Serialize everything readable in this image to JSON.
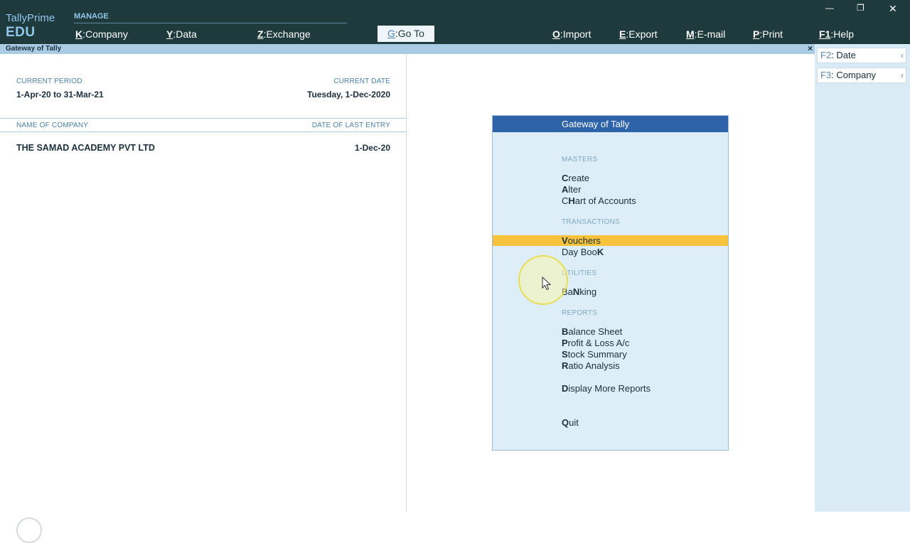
{
  "brand": {
    "name": "TallyPrime",
    "edition": "EDU"
  },
  "manage": {
    "label": "MANAGE"
  },
  "menu": [
    {
      "key": "K",
      "label": "Company"
    },
    {
      "key": "Y",
      "label": "Data"
    },
    {
      "key": "Z",
      "label": "Exchange"
    },
    {
      "key": "G",
      "label": "Go To"
    },
    {
      "key": "O",
      "label": "Import"
    },
    {
      "key": "E",
      "label": "Export"
    },
    {
      "key": "M",
      "label": "E-mail"
    },
    {
      "key": "P",
      "label": "Print"
    },
    {
      "key": "F1",
      "label": "Help"
    }
  ],
  "window_controls": {
    "minimize": "—",
    "restore": "❐",
    "close": "✕"
  },
  "subbar": {
    "title": "Gateway of Tally",
    "close": "×"
  },
  "sidebar": [
    {
      "key": "F2",
      "label": "Date",
      "chevron": "‹"
    },
    {
      "key": "F3",
      "label": "Company",
      "chevron": "‹"
    }
  ],
  "period": {
    "label": "CURRENT PERIOD",
    "value": "1-Apr-20 to 31-Mar-21",
    "date_label": "CURRENT DATE",
    "date_value": "Tuesday, 1-Dec-2020"
  },
  "company_table": {
    "col_name": "NAME OF COMPANY",
    "col_date": "DATE OF LAST ENTRY",
    "rows": [
      {
        "name": "THE SAMAD ACADEMY PVT LTD",
        "date": "1-Dec-20"
      }
    ]
  },
  "gateway": {
    "title": "Gateway of Tally",
    "masters": {
      "label": "MASTERS",
      "items": [
        {
          "hot": "C",
          "rest": "reate"
        },
        {
          "hot": "A",
          "rest": "lter"
        },
        {
          "pre": "C",
          "hot": "H",
          "rest": "art of Accounts"
        }
      ]
    },
    "transactions": {
      "label": "TRANSACTIONS",
      "items": [
        {
          "hot": "V",
          "rest": "ouchers"
        },
        {
          "pre": "Day Boo",
          "hot": "K",
          "rest": ""
        }
      ]
    },
    "utilities": {
      "label": "UTILITIES",
      "items": [
        {
          "pre": "Ba",
          "hot": "N",
          "rest": "king"
        }
      ]
    },
    "reports": {
      "label": "REPORTS",
      "items": [
        {
          "hot": "B",
          "rest": "alance Sheet"
        },
        {
          "hot": "P",
          "rest": "rofit & Loss A/c"
        },
        {
          "hot": "S",
          "rest": "tock Summary"
        },
        {
          "hot": "R",
          "rest": "atio Analysis"
        },
        {
          "hot": "D",
          "rest": "isplay More Reports"
        }
      ]
    },
    "quit": {
      "hot": "Q",
      "rest": "uit"
    }
  },
  "colors": {
    "topbar": "#1f3a3d",
    "accent": "#2e63aa",
    "highlight": "#f7c33c",
    "panel": "#ddeef8"
  }
}
